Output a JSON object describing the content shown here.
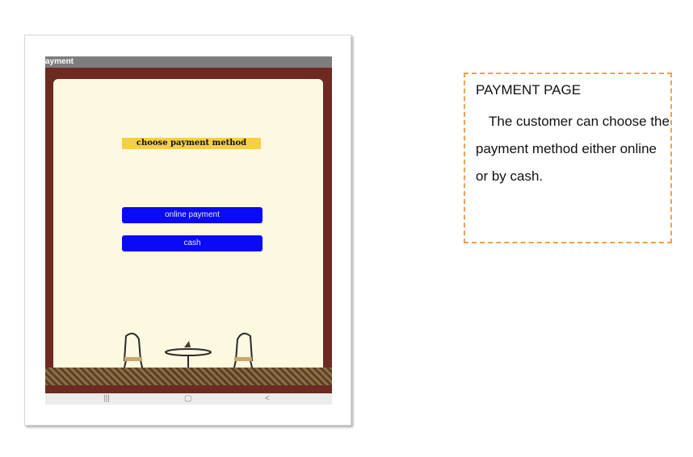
{
  "app": {
    "title_bar": "ayment",
    "heading": "choose payment method",
    "buttons": {
      "online": "online payment",
      "cash": "cash"
    },
    "nav_icons": [
      "recents-icon",
      "home-icon",
      "back-icon"
    ]
  },
  "note": {
    "title": "PAYMENT PAGE",
    "body": "The customer can choose the payment method either online or by cash."
  },
  "colors": {
    "button": "#0a0af5",
    "heading_highlight": "#f6cf45",
    "frame": "#6e2a20",
    "paper": "#fdf8e0",
    "note_border": "#f0a050"
  }
}
